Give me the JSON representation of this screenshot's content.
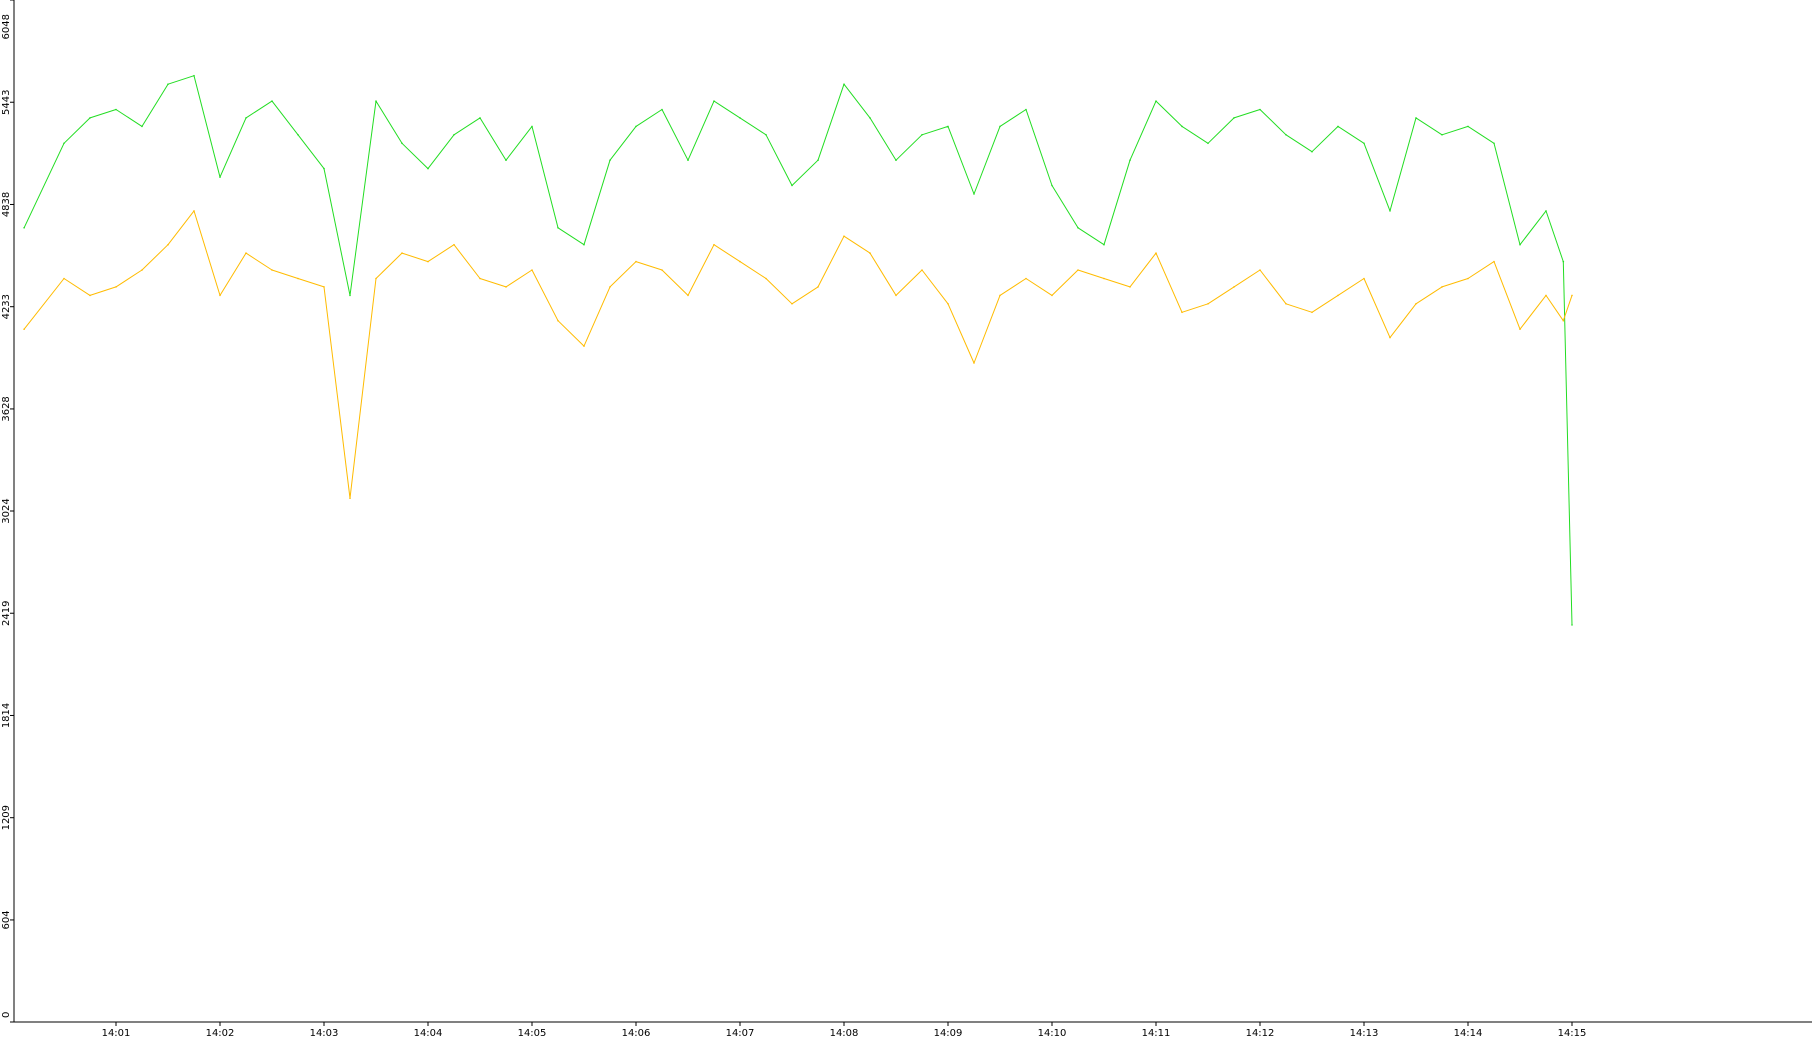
{
  "chart_data": {
    "type": "line",
    "title": "",
    "xlabel": "",
    "ylabel": "",
    "ylim": [
      0,
      6048
    ],
    "y_ticks": [
      "0",
      "604",
      "1209",
      "1814",
      "2419",
      "3024",
      "3628",
      "4233",
      "4838",
      "5443",
      "6048"
    ],
    "x_ticks": [
      "14:01",
      "14:02",
      "14:03",
      "14:04",
      "14:05",
      "14:06",
      "14:07",
      "14:08",
      "14:09",
      "14:10",
      "14:11",
      "14:12",
      "14:13",
      "14:14",
      "14:15"
    ],
    "x_start": "14:00:07",
    "x_end": "14:15:00",
    "grid": false,
    "legend": "none",
    "series": [
      {
        "color": "#22dd22",
        "x": [
          "14:00:07",
          "14:00:30",
          "14:00:45",
          "14:01:00",
          "14:01:15",
          "14:01:30",
          "14:01:45",
          "14:02:00",
          "14:02:15",
          "14:02:30",
          "14:02:45",
          "14:03:00",
          "14:03:15",
          "14:03:30",
          "14:03:45",
          "14:04:00",
          "14:04:15",
          "14:04:30",
          "14:04:45",
          "14:05:00",
          "14:05:15",
          "14:05:30",
          "14:05:45",
          "14:06:00",
          "14:06:15",
          "14:06:30",
          "14:06:45",
          "14:07:00",
          "14:07:15",
          "14:07:30",
          "14:07:45",
          "14:08:00",
          "14:08:15",
          "14:08:30",
          "14:08:45",
          "14:09:00",
          "14:09:15",
          "14:09:30",
          "14:09:45",
          "14:10:00",
          "14:10:15",
          "14:10:30",
          "14:10:45",
          "14:11:00",
          "14:11:15",
          "14:11:30",
          "14:11:45",
          "14:12:00",
          "14:12:15",
          "14:12:30",
          "14:12:45",
          "14:13:00",
          "14:13:15",
          "14:13:30",
          "14:13:45",
          "14:14:00",
          "14:14:15",
          "14:14:30",
          "14:14:45",
          "14:14:55",
          "14:15:00"
        ],
        "y": [
          4700,
          5200,
          5350,
          5400,
          5300,
          5550,
          5600,
          5000,
          5350,
          5450,
          5250,
          5050,
          4300,
          5450,
          5200,
          5050,
          5250,
          5350,
          5100,
          5300,
          4700,
          4600,
          5100,
          5300,
          5400,
          5100,
          5450,
          5350,
          5250,
          4950,
          5100,
          5550,
          5350,
          5100,
          5250,
          5300,
          4900,
          5300,
          5400,
          4950,
          4700,
          4600,
          5100,
          5450,
          5300,
          5200,
          5350,
          5400,
          5250,
          5150,
          5300,
          5200,
          4800,
          5350,
          5250,
          5300,
          5200,
          4600,
          4800,
          4500,
          2350
        ]
      },
      {
        "color": "#ffbb00",
        "x": [
          "14:00:07",
          "14:00:30",
          "14:00:45",
          "14:01:00",
          "14:01:15",
          "14:01:30",
          "14:01:45",
          "14:02:00",
          "14:02:15",
          "14:02:30",
          "14:02:45",
          "14:03:00",
          "14:03:15",
          "14:03:30",
          "14:03:45",
          "14:04:00",
          "14:04:15",
          "14:04:30",
          "14:04:45",
          "14:05:00",
          "14:05:15",
          "14:05:30",
          "14:05:45",
          "14:06:00",
          "14:06:15",
          "14:06:30",
          "14:06:45",
          "14:07:00",
          "14:07:15",
          "14:07:30",
          "14:07:45",
          "14:08:00",
          "14:08:15",
          "14:08:30",
          "14:08:45",
          "14:09:00",
          "14:09:15",
          "14:09:30",
          "14:09:45",
          "14:10:00",
          "14:10:15",
          "14:10:30",
          "14:10:45",
          "14:11:00",
          "14:11:15",
          "14:11:30",
          "14:11:45",
          "14:12:00",
          "14:12:15",
          "14:12:30",
          "14:12:45",
          "14:13:00",
          "14:13:15",
          "14:13:30",
          "14:13:45",
          "14:14:00",
          "14:14:15",
          "14:14:30",
          "14:14:45",
          "14:14:55",
          "14:15:00"
        ],
        "y": [
          4100,
          4400,
          4300,
          4350,
          4450,
          4600,
          4800,
          4300,
          4550,
          4450,
          4400,
          4350,
          3100,
          4400,
          4550,
          4500,
          4600,
          4400,
          4350,
          4450,
          4150,
          4000,
          4350,
          4500,
          4450,
          4300,
          4600,
          4500,
          4400,
          4250,
          4350,
          4650,
          4550,
          4300,
          4450,
          4250,
          3900,
          4300,
          4400,
          4300,
          4450,
          4400,
          4350,
          4550,
          4200,
          4250,
          4350,
          4450,
          4250,
          4200,
          4300,
          4400,
          4050,
          4250,
          4350,
          4400,
          4500,
          4100,
          4300,
          4150,
          4300
        ]
      }
    ]
  }
}
